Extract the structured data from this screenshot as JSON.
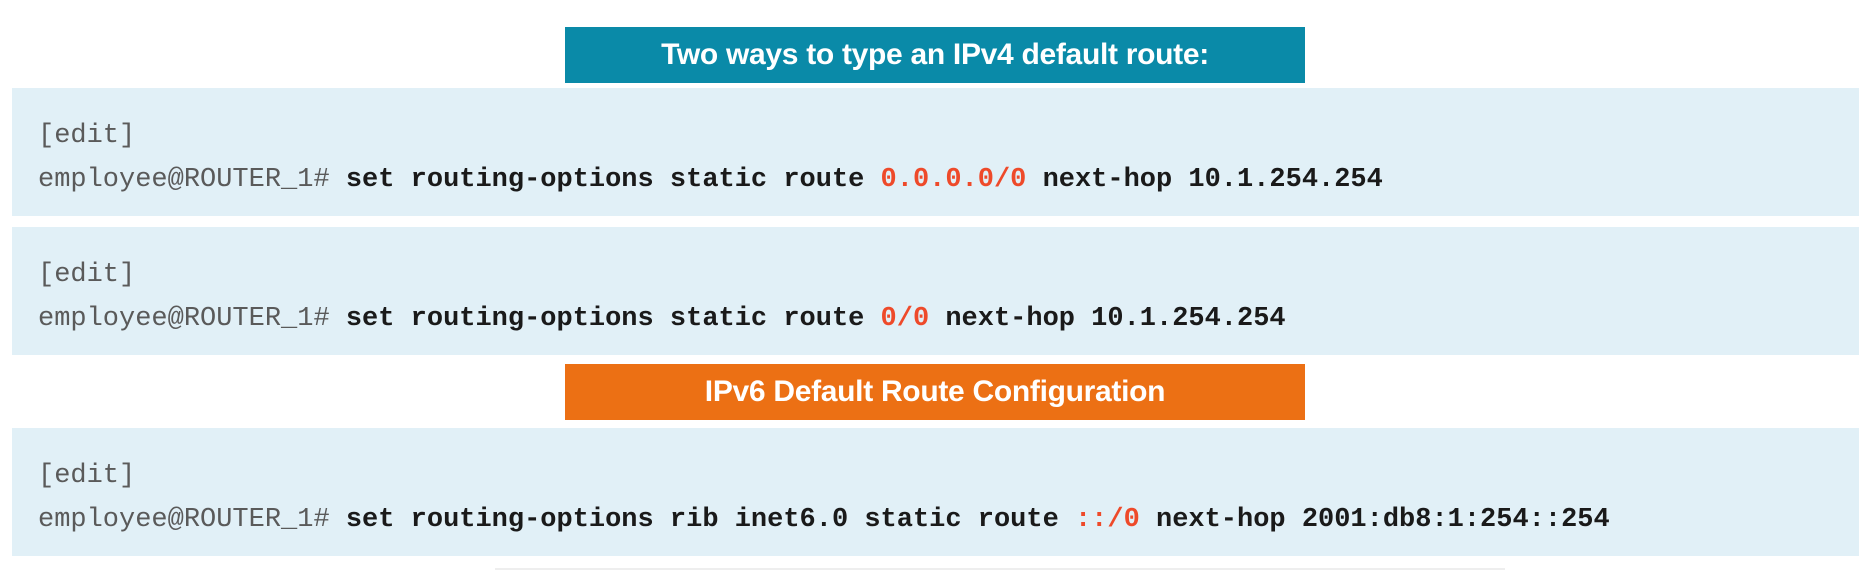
{
  "ipv4_banner": "Two ways to type an IPv4 default route:",
  "ipv6_banner": "IPv6 Default Route Configuration",
  "blocks": [
    {
      "context": "[edit]",
      "prompt": "employee@ROUTER_1# ",
      "cmd_before": "set routing-options static route ",
      "highlight": "0.0.0.0/0",
      "cmd_after": " next-hop 10.1.254.254"
    },
    {
      "context": "[edit]",
      "prompt": "employee@ROUTER_1# ",
      "cmd_before": "set routing-options static route ",
      "highlight": "0/0",
      "cmd_after": " next-hop 10.1.254.254"
    },
    {
      "context": "[edit]",
      "prompt": "employee@ROUTER_1# ",
      "cmd_before": "set routing-options rib inet6.0 static route ",
      "highlight": "::/0",
      "cmd_after": " next-hop 2001:db8:1:254::254"
    }
  ],
  "colors": {
    "ipv4_banner_bg": "#0a8aa8",
    "ipv6_banner_bg": "#ec7014",
    "code_bg": "#e1f0f7",
    "highlight": "#ee4a2a"
  }
}
